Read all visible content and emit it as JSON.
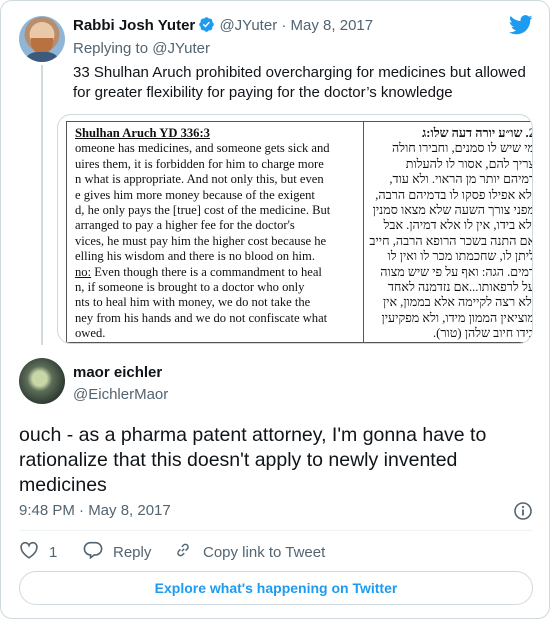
{
  "colors": {
    "accent": "#1d9bf0",
    "text": "#0f1419",
    "muted": "#536471",
    "border": "#cfd9de"
  },
  "parent_tweet": {
    "author_name": "Rabbi Josh Yuter",
    "handle": "@JYuter",
    "date": "May 8, 2017",
    "replying_to_label": "Replying to",
    "replying_to_handle": "@JYuter",
    "text": "33 Shulhan Aruch prohibited overcharging for medicines but allowed for greater flexibility for paying for the doctor’s knowledge",
    "verified_icon": "verified-badge-icon",
    "media": {
      "left_title": "Shulhan Aruch YD 336:3",
      "left_lines": [
        "omeone has medicines, and someone gets sick and",
        "uires them, it is forbidden for him to charge more",
        "n what is appropriate.  And not only this, but even",
        "e gives him more money because of the exigent",
        "d, he only pays the [true] cost of the medicine.  But",
        "arranged to pay a higher fee for the doctor's",
        "vices, he must pay him the higher cost because he",
        "elling his wisdom and there is no blood on him.",
        "no: Even though there is a commandment to heal",
        "n, if someone is brought to a doctor who only",
        "nts to heal him with money, we do not take the",
        "ney from his hands and we do not confiscate what",
        "owed."
      ],
      "left_underline_word": "no:",
      "right_title": "2. שו״ע יורה דעה שלו:ג",
      "right_lines": [
        "מי שיש לו סמנים, וחבירו חולה",
        "צריך להם, אסור לו להעלות",
        "דמיהם יותר מן הראוי. ולא עוד,",
        "ולא אפילו פסקו לו בדמיהם הרבה,",
        "מפני צורך השעה שלא מצאו סמנין",
        "ולא בידו, אין לו אלא דמיהן. אבל",
        "אם התנה בשכר הרופא הרבה, חייב",
        "ליתן לו, שחכמתו מכר לו ואין לו",
        "דמים. הגה: ואף על פי שיש מצוה",
        "על לרפאותו...אם נזדמנה לאחד",
        "ולא רצה לקיימה אלא בממון, אין",
        "מוציאין הממון מידו, ולא מפקיעין",
        "בידו חיוב שלהן (טור)."
      ]
    }
  },
  "main_tweet": {
    "author_name": "maor eichler",
    "handle": "@EichlerMaor",
    "text": "ouch - as a pharma patent attorney, I'm gonna have to rationalize that this doesn't apply to newly invented medicines",
    "timestamp": "9:48 PM · May 8, 2017"
  },
  "actions": {
    "like_count": "1",
    "reply_label": "Reply",
    "copy_link_label": "Copy link to Tweet"
  },
  "explore_label": "Explore what's happening on Twitter",
  "icons": [
    "twitter-bird-icon",
    "verified-badge-icon",
    "info-icon",
    "heart-icon",
    "reply-icon",
    "link-icon"
  ]
}
